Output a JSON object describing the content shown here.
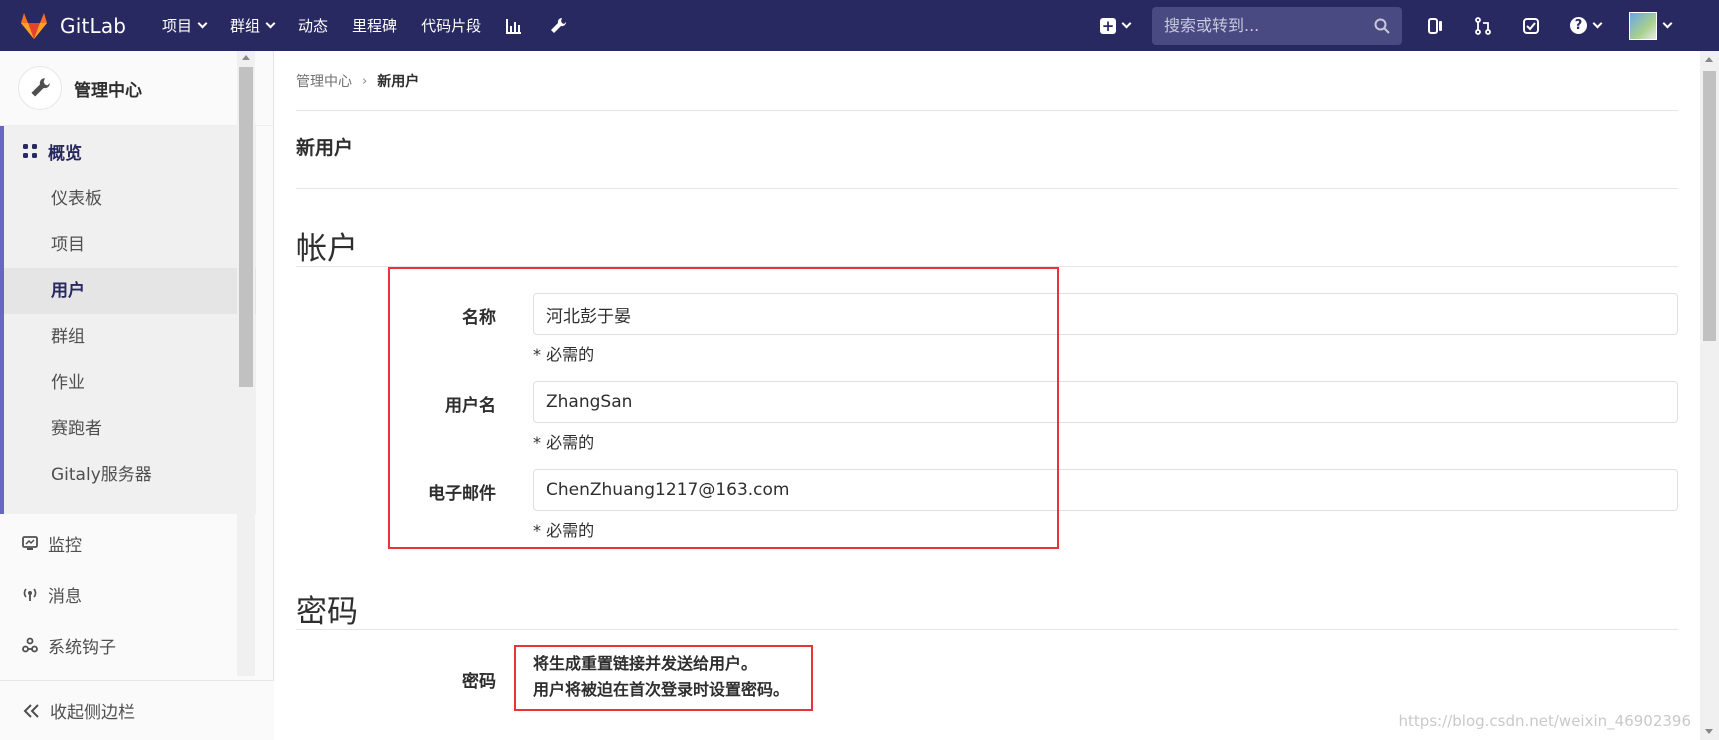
{
  "navbar": {
    "brand": "GitLab",
    "items": [
      {
        "label": "项目",
        "dropdown": true
      },
      {
        "label": "群组",
        "dropdown": true
      },
      {
        "label": "动态",
        "dropdown": false
      },
      {
        "label": "里程碑",
        "dropdown": false
      },
      {
        "label": "代码片段",
        "dropdown": false
      }
    ],
    "search_placeholder": "搜索或转到...",
    "help_glyph": "?",
    "plus_glyph": "+",
    "icons": [
      "chart-icon",
      "wrench-icon",
      "plus-icon",
      "search-icon",
      "issues-icon",
      "merge-request-icon",
      "todo-icon",
      "help-icon",
      "avatar"
    ]
  },
  "sidebar": {
    "title": "管理中心",
    "group": {
      "label": "概览",
      "items": [
        {
          "label": "仪表板",
          "active": false
        },
        {
          "label": "项目",
          "active": false
        },
        {
          "label": "用户",
          "active": true
        },
        {
          "label": "群组",
          "active": false
        },
        {
          "label": "作业",
          "active": false
        },
        {
          "label": "赛跑者",
          "active": false
        },
        {
          "label": "Gitaly服务器",
          "active": false
        }
      ]
    },
    "items": [
      {
        "label": "监控",
        "icon": "monitor-icon"
      },
      {
        "label": "消息",
        "icon": "broadcast-icon"
      },
      {
        "label": "系统钩子",
        "icon": "hook-icon"
      }
    ],
    "collapse_label": "收起侧边栏"
  },
  "breadcrumb": {
    "parent": "管理中心",
    "separator": "›",
    "current": "新用户"
  },
  "page_title": "新用户",
  "account": {
    "section_title": "帐户",
    "name": {
      "label": "名称",
      "value": "河北彭于晏",
      "help": "* 必需的"
    },
    "username": {
      "label": "用户名",
      "value": "ZhangSan",
      "help": "* 必需的"
    },
    "email": {
      "label": "电子邮件",
      "value": "ChenZhuang1217@163.com",
      "help": "* 必需的"
    }
  },
  "password": {
    "section_title": "密码",
    "label": "密码",
    "note_line1": "将生成重置链接并发送给用户。",
    "note_line2": "用户将被迫在首次登录时设置密码。"
  },
  "colors": {
    "navbar": "#292961",
    "accent": "#6666c4",
    "highlight": "#e8333a"
  },
  "watermark": "https://blog.csdn.net/weixin_46902396"
}
